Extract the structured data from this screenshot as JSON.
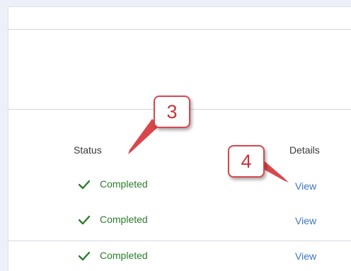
{
  "table": {
    "headers": {
      "status": "Status",
      "details": "Details"
    },
    "rows": [
      {
        "status": "Completed",
        "details": "View"
      },
      {
        "status": "Completed",
        "details": "View"
      },
      {
        "status": "Completed",
        "details": "View"
      }
    ]
  },
  "callouts": [
    {
      "label": "3"
    },
    {
      "label": "4"
    }
  ],
  "colors": {
    "status_completed": "#2b7d2b",
    "link": "#3d75c4",
    "callout": "#d9474d"
  },
  "icons": {
    "status": "checkmark-icon"
  }
}
